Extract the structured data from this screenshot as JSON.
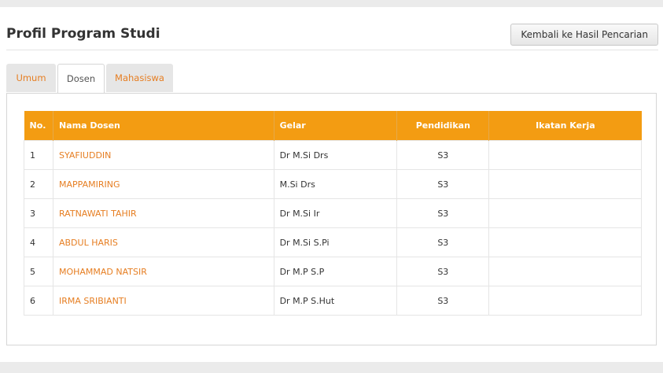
{
  "header": {
    "title": "Profil Program Studi",
    "back_label": "Kembali ke Hasil Pencarian"
  },
  "tabs": [
    {
      "label": "Umum",
      "active": false
    },
    {
      "label": "Dosen",
      "active": true
    },
    {
      "label": "Mahasiswa",
      "active": false
    }
  ],
  "table": {
    "headers": [
      "No.",
      "Nama Dosen",
      "Gelar",
      "Pendidikan",
      "Ikatan Kerja"
    ],
    "rows": [
      {
        "no": "1",
        "nama": "SYAFIUDDIN",
        "gelar": "Dr M.Si Drs",
        "pendidikan": "S3",
        "ikatan": ""
      },
      {
        "no": "2",
        "nama": "MAPPAMIRING",
        "gelar": "M.Si Drs",
        "pendidikan": "S3",
        "ikatan": ""
      },
      {
        "no": "3",
        "nama": "RATNAWATI TAHIR",
        "gelar": "Dr M.Si Ir",
        "pendidikan": "S3",
        "ikatan": ""
      },
      {
        "no": "4",
        "nama": "ABDUL HARIS",
        "gelar": "Dr M.Si S.Pi",
        "pendidikan": "S3",
        "ikatan": ""
      },
      {
        "no": "5",
        "nama": "MOHAMMAD NATSIR",
        "gelar": "Dr M.P S.P",
        "pendidikan": "S3",
        "ikatan": ""
      },
      {
        "no": "6",
        "nama": "IRMA SRIBIANTI",
        "gelar": "Dr M.P S.Hut",
        "pendidikan": "S3",
        "ikatan": ""
      }
    ]
  },
  "colors": {
    "accent": "#f39c12",
    "link": "#e67e22"
  }
}
